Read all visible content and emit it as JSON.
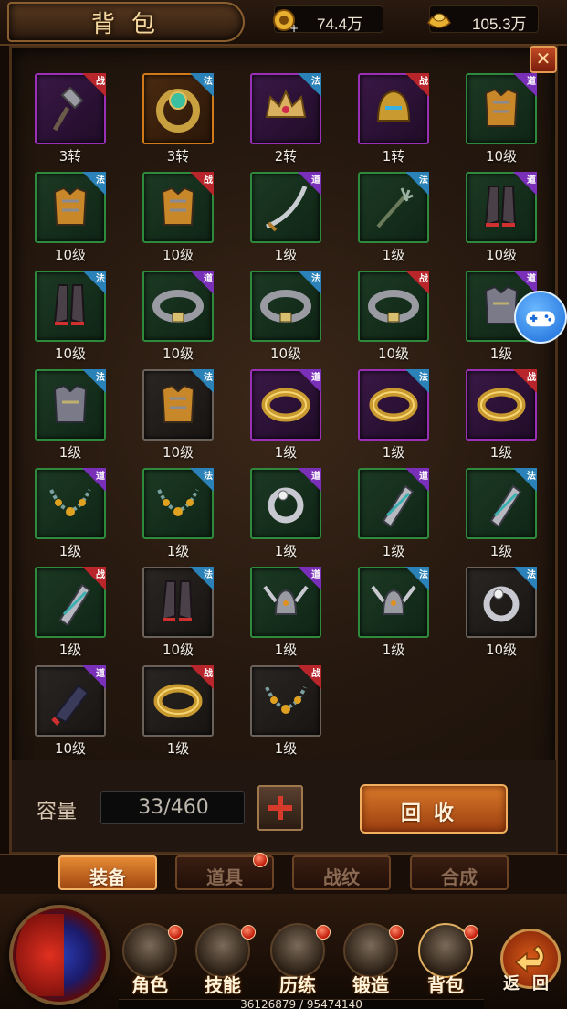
{
  "header": {
    "title": "背包",
    "gold": "74.4万",
    "ingot": "105.3万"
  },
  "colors": {
    "grade_green": "#2e8a3c",
    "grade_purple": "#9a2fb8",
    "grade_orange": "#d07a1a",
    "grade_gray": "#6a625a",
    "tag_zhan": "#b8252a",
    "tag_fa": "#2a82b8",
    "tag_dao": "#7a2fb8"
  },
  "items": [
    {
      "level": "3转",
      "grade": "purple",
      "tag": "战",
      "icon": "mace-icon"
    },
    {
      "level": "3转",
      "grade": "orange",
      "tag": "法",
      "icon": "jeweled-ring-icon"
    },
    {
      "level": "2转",
      "grade": "purple",
      "tag": "法",
      "icon": "gold-crown-icon"
    },
    {
      "level": "1转",
      "grade": "purple",
      "tag": "战",
      "icon": "horned-helmet-icon"
    },
    {
      "level": "10级",
      "grade": "green",
      "tag": "道",
      "icon": "chest-armor-icon"
    },
    {
      "level": "10级",
      "grade": "green",
      "tag": "法",
      "icon": "chest-armor-icon"
    },
    {
      "level": "10级",
      "grade": "green",
      "tag": "战",
      "icon": "chest-armor-icon"
    },
    {
      "level": "1级",
      "grade": "green",
      "tag": "道",
      "icon": "curved-sword-icon"
    },
    {
      "level": "1级",
      "grade": "green",
      "tag": "法",
      "icon": "trident-icon"
    },
    {
      "level": "10级",
      "grade": "green",
      "tag": "道",
      "icon": "boots-icon"
    },
    {
      "level": "10级",
      "grade": "green",
      "tag": "法",
      "icon": "boots-icon"
    },
    {
      "level": "10级",
      "grade": "green",
      "tag": "道",
      "icon": "belt-icon"
    },
    {
      "level": "10级",
      "grade": "green",
      "tag": "法",
      "icon": "belt-icon"
    },
    {
      "level": "10级",
      "grade": "green",
      "tag": "战",
      "icon": "belt-icon"
    },
    {
      "level": "1级",
      "grade": "green",
      "tag": "道",
      "icon": "steel-armor-icon"
    },
    {
      "level": "1级",
      "grade": "green",
      "tag": "法",
      "icon": "steel-armor-icon"
    },
    {
      "level": "10级",
      "grade": "gray",
      "tag": "法",
      "icon": "chest-armor-icon"
    },
    {
      "level": "1级",
      "grade": "purple",
      "tag": "道",
      "icon": "gold-bracelet-icon"
    },
    {
      "level": "1级",
      "grade": "purple",
      "tag": "法",
      "icon": "gold-bracelet-icon"
    },
    {
      "level": "1级",
      "grade": "purple",
      "tag": "战",
      "icon": "gold-bracelet-icon"
    },
    {
      "level": "1级",
      "grade": "green",
      "tag": "道",
      "icon": "necklace-icon"
    },
    {
      "level": "1级",
      "grade": "green",
      "tag": "法",
      "icon": "necklace-icon"
    },
    {
      "level": "1级",
      "grade": "green",
      "tag": "道",
      "icon": "silver-ring-icon"
    },
    {
      "level": "1级",
      "grade": "green",
      "tag": "道",
      "icon": "bracer-icon"
    },
    {
      "level": "1级",
      "grade": "green",
      "tag": "法",
      "icon": "bracer-icon"
    },
    {
      "level": "1级",
      "grade": "green",
      "tag": "战",
      "icon": "bracer-icon"
    },
    {
      "level": "10级",
      "grade": "gray",
      "tag": "法",
      "icon": "boots-icon"
    },
    {
      "level": "1级",
      "grade": "green",
      "tag": "道",
      "icon": "winged-helmet-icon"
    },
    {
      "level": "1级",
      "grade": "green",
      "tag": "法",
      "icon": "winged-helmet-icon"
    },
    {
      "level": "10级",
      "grade": "gray",
      "tag": "法",
      "icon": "silver-ring-icon"
    },
    {
      "level": "10级",
      "grade": "gray",
      "tag": "道",
      "icon": "gauntlet-icon"
    },
    {
      "level": "1级",
      "grade": "gray",
      "tag": "战",
      "icon": "gold-bracelet-icon"
    },
    {
      "level": "1级",
      "grade": "gray",
      "tag": "战",
      "icon": "necklace-icon"
    }
  ],
  "capacity": {
    "label": "容量",
    "value": "33/460",
    "recycle_label": "回收"
  },
  "tabs": [
    {
      "label": "装备",
      "active": true,
      "dot": false
    },
    {
      "label": "道具",
      "active": false,
      "dot": true
    },
    {
      "label": "战纹",
      "active": false,
      "dot": false
    },
    {
      "label": "合成",
      "active": false,
      "dot": false
    }
  ],
  "nav": [
    {
      "label": "角色",
      "icon": "knight-helmet-icon",
      "dot": true
    },
    {
      "label": "技能",
      "icon": "dragon-skill-icon",
      "dot": true
    },
    {
      "label": "历练",
      "icon": "armored-helmet-icon",
      "dot": true
    },
    {
      "label": "锻造",
      "icon": "forge-hammer-icon",
      "dot": true
    },
    {
      "label": "背包",
      "icon": "bag-icon",
      "dot": true
    }
  ],
  "return_label": "返回",
  "exp_text": "36126879 / 95474140"
}
